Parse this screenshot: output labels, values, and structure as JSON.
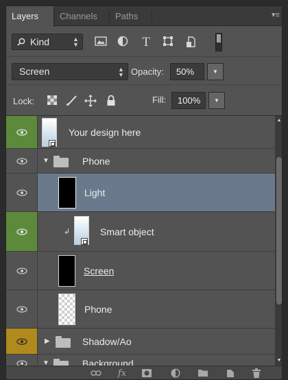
{
  "tabs": [
    {
      "label": "Layers",
      "active": true
    },
    {
      "label": "Channels",
      "active": false
    },
    {
      "label": "Paths",
      "active": false
    }
  ],
  "filter": {
    "kind_label": "Kind",
    "icons": [
      "image-filter-icon",
      "adjustment-filter-icon",
      "type-filter-icon",
      "shape-filter-icon",
      "smart-object-filter-icon"
    ]
  },
  "blend": {
    "mode": "Screen",
    "opacity_label": "Opacity:",
    "opacity_value": "50%"
  },
  "lock": {
    "label": "Lock:",
    "fill_label": "Fill:",
    "fill_value": "100%"
  },
  "layers": [
    {
      "name": "Your design here",
      "type": "smart-object",
      "eye": "green"
    },
    {
      "name": "Phone",
      "type": "group-open"
    },
    {
      "name": "Light",
      "type": "black-thumb",
      "selected": true
    },
    {
      "name": "Smart object",
      "type": "smart-object-clipped",
      "eye": "green"
    },
    {
      "name": "Screen",
      "type": "black-thumb"
    },
    {
      "name": "Phone",
      "type": "checker-thumb"
    },
    {
      "name": "Shadow/Ao",
      "type": "group-closed",
      "eye": "yellow"
    },
    {
      "name": "Background",
      "type": "group-open"
    }
  ],
  "colors": {
    "panel": "#535353",
    "visible_green": "#5c8a3a",
    "visible_yellow": "#b08a1c",
    "selection": "#6a7a8c"
  }
}
